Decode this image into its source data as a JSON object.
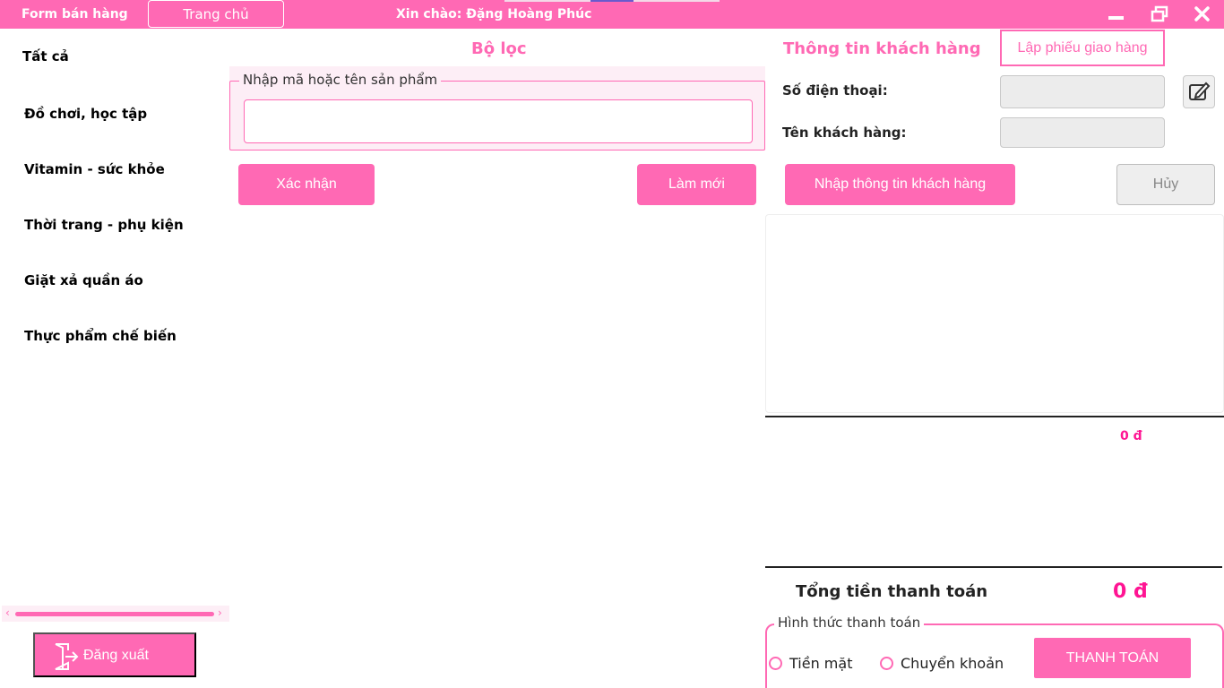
{
  "titlebar": {
    "app_title": "Form bán hàng",
    "home_label": "Trang chủ",
    "greeting": "Xin chào: Đặng Hoàng Phúc",
    "icons": [
      "minimize-icon",
      "restore-icon",
      "close-icon"
    ]
  },
  "sidebar": {
    "items": [
      {
        "label": "Tất cả"
      },
      {
        "label": "Đồ chơi, học tập"
      },
      {
        "label": "Vitamin - sức khỏe"
      },
      {
        "label": "Thời trang - phụ kiện"
      },
      {
        "label": "Giặt xả quần áo"
      },
      {
        "label": "Thực phẩm chế biến"
      }
    ],
    "logout_label": "Đăng xuất"
  },
  "filter": {
    "title": "Bộ lọc",
    "legend": "Nhập mã hoặc tên sản phẩm",
    "input_value": "",
    "confirm_label": "Xác nhận",
    "refresh_label": "Làm mới"
  },
  "customer": {
    "title": "Thông tin khách hàng",
    "delivery_label": "Lập phiếu giao hàng",
    "phone_label": "Số điện thoại:",
    "name_label": "Tên khách hàng:",
    "enter_info_label": "Nhập thông tin khách hàng",
    "cancel_label": "Hủy"
  },
  "order": {
    "subtotal": "0 đ",
    "total_label": "Tổng tiền thanh toán",
    "total_value": "0 đ"
  },
  "payment": {
    "legend": "Hình thức thanh toán",
    "options": [
      {
        "label": "Tiền mặt"
      },
      {
        "label": "Chuyển khoản"
      }
    ],
    "pay_label": "THANH TOÁN"
  },
  "colors": {
    "accent": "#ff69b4",
    "accent_dark": "#ff1493"
  }
}
